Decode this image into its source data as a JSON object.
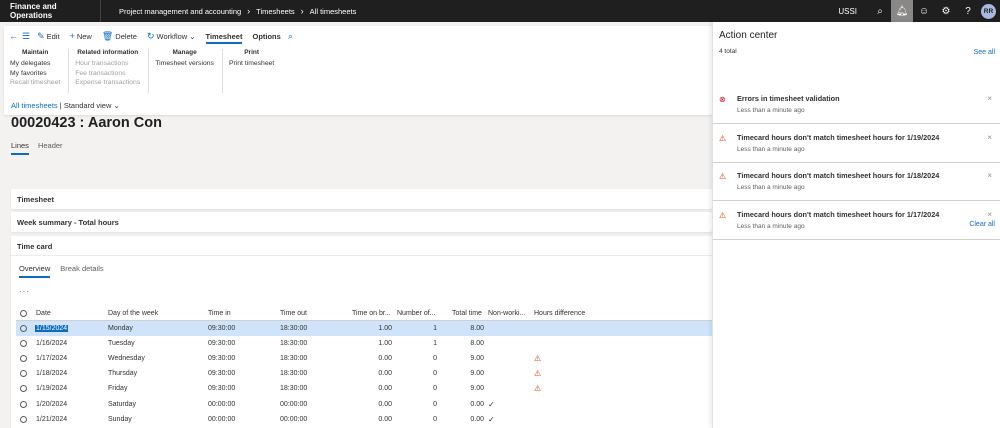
{
  "topbar": {
    "app_name": "Finance and Operations",
    "breadcrumbs": [
      "Project management and accounting",
      "Timesheets",
      "All timesheets"
    ],
    "company": "USSI",
    "avatar_initials": "RR"
  },
  "actionpane": {
    "edit": "Edit",
    "new": "New",
    "delete": "Delete",
    "workflow": "Workflow",
    "tab_timesheet": "Timesheet",
    "tab_options": "Options",
    "groups": {
      "maintain": {
        "title": "Maintain",
        "items": [
          "My delegates",
          "My favorites",
          "Recall timesheet"
        ]
      },
      "related": {
        "title": "Related information",
        "items": [
          "Hour transactions",
          "Fee transactions",
          "Expense transactions"
        ]
      },
      "manage": {
        "title": "Manage",
        "items": [
          "Timesheet versions"
        ]
      },
      "print": {
        "title": "Print",
        "items": [
          "Print timesheet"
        ]
      }
    }
  },
  "page": {
    "breadcrumb_link": "All timesheets",
    "view": "Standard view",
    "title": "00020423 : Aaron Con",
    "tabs": [
      "Lines",
      "Header"
    ]
  },
  "fasttabs": {
    "timesheet": "Timesheet",
    "week_summary": "Week summary - Total hours",
    "time_card": "Time card"
  },
  "timecard": {
    "tabs": [
      "Overview",
      "Break details"
    ],
    "columns": [
      "Date",
      "Day of the week",
      "Time in",
      "Time out",
      "Time on br...",
      "Number of...",
      "Total time",
      "Non-worki...",
      "Hours difference"
    ],
    "rows": [
      {
        "date": "1/15/2024",
        "day": "Monday",
        "in": "09:30:00",
        "out": "18:30:00",
        "brk": "1.00",
        "num": "1",
        "total": "8.00"
      },
      {
        "date": "1/16/2024",
        "day": "Tuesday",
        "in": "09:30:00",
        "out": "18:30:00",
        "brk": "1.00",
        "num": "1",
        "total": "8.00"
      },
      {
        "date": "1/17/2024",
        "day": "Wednesday",
        "in": "09:30:00",
        "out": "18:30:00",
        "brk": "0.00",
        "num": "0",
        "total": "9.00"
      },
      {
        "date": "1/18/2024",
        "day": "Thursday",
        "in": "09:30:00",
        "out": "18:30:00",
        "brk": "0.00",
        "num": "0",
        "total": "9.00"
      },
      {
        "date": "1/19/2024",
        "day": "Friday",
        "in": "09:30:00",
        "out": "18:30:00",
        "brk": "0.00",
        "num": "0",
        "total": "9.00"
      },
      {
        "date": "1/20/2024",
        "day": "Saturday",
        "in": "00:00:00",
        "out": "00:00:00",
        "brk": "0.00",
        "num": "0",
        "total": "0.00"
      },
      {
        "date": "1/21/2024",
        "day": "Sunday",
        "in": "00:00:00",
        "out": "00:00:00",
        "brk": "0.00",
        "num": "0",
        "total": "0.00"
      }
    ]
  },
  "action_center": {
    "title": "Action center",
    "total": "4 total",
    "see_all": "See all",
    "clear_all": "Clear all",
    "items": [
      {
        "message": "Errors in timesheet validation",
        "time": "Less than a minute ago",
        "severity": "error"
      },
      {
        "message": "Timecard hours don't match timesheet hours for 1/19/2024",
        "time": "Less than a minute ago",
        "severity": "warning"
      },
      {
        "message": "Timecard hours don't match timesheet hours for 1/18/2024",
        "time": "Less than a minute ago",
        "severity": "warning"
      },
      {
        "message": "Timecard hours don't match timesheet hours for 1/17/2024",
        "time": "Less than a minute ago",
        "severity": "warning"
      }
    ]
  },
  "colors": {
    "accent": "#0f6cbd",
    "topbar": "#1f1f1f",
    "error": "#c50f1f",
    "warning": "#d83b01",
    "selected_row": "#cfe4fa"
  }
}
